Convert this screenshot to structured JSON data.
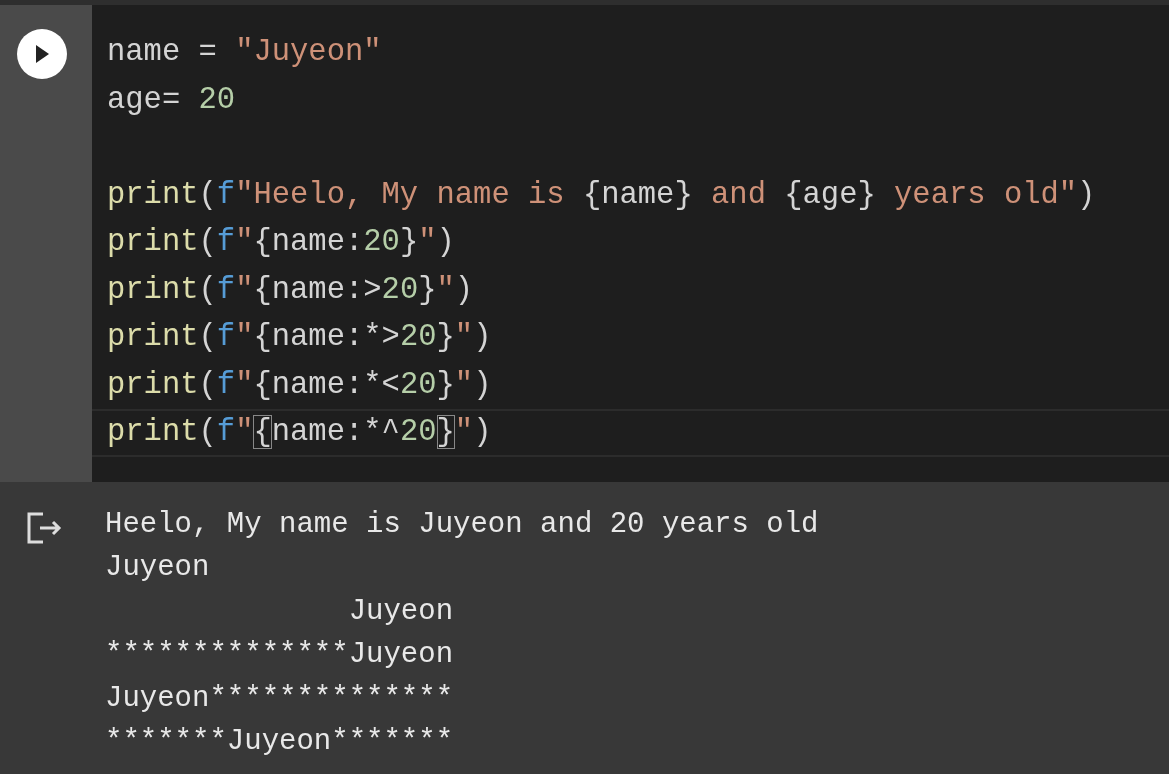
{
  "code_cell": {
    "lines": [
      {
        "kind": "code",
        "current": false,
        "tokens": [
          {
            "kind": "plain",
            "text": "name = "
          },
          {
            "kind": "string",
            "text": "\"Juyeon\""
          }
        ]
      },
      {
        "kind": "code",
        "current": false,
        "tokens": [
          {
            "kind": "plain",
            "text": "age= "
          },
          {
            "kind": "number",
            "text": "20"
          }
        ]
      },
      {
        "kind": "blank"
      },
      {
        "kind": "code",
        "current": false,
        "tokens": [
          {
            "kind": "function",
            "text": "print"
          },
          {
            "kind": "plain",
            "text": "("
          },
          {
            "kind": "prefix",
            "text": "f"
          },
          {
            "kind": "string",
            "text": "\"Heelo, My name is "
          },
          {
            "kind": "plain",
            "text": "{name}"
          },
          {
            "kind": "string",
            "text": " and "
          },
          {
            "kind": "plain",
            "text": "{age}"
          },
          {
            "kind": "string",
            "text": " years old\""
          },
          {
            "kind": "plain",
            "text": ")"
          }
        ]
      },
      {
        "kind": "code",
        "current": false,
        "tokens": [
          {
            "kind": "function",
            "text": "print"
          },
          {
            "kind": "plain",
            "text": "("
          },
          {
            "kind": "prefix",
            "text": "f"
          },
          {
            "kind": "string",
            "text": "\""
          },
          {
            "kind": "plain",
            "text": "{name:"
          },
          {
            "kind": "number",
            "text": "20"
          },
          {
            "kind": "plain",
            "text": "}"
          },
          {
            "kind": "string",
            "text": "\""
          },
          {
            "kind": "plain",
            "text": ")"
          }
        ]
      },
      {
        "kind": "code",
        "current": false,
        "tokens": [
          {
            "kind": "function",
            "text": "print"
          },
          {
            "kind": "plain",
            "text": "("
          },
          {
            "kind": "prefix",
            "text": "f"
          },
          {
            "kind": "string",
            "text": "\""
          },
          {
            "kind": "plain",
            "text": "{name:>"
          },
          {
            "kind": "number",
            "text": "20"
          },
          {
            "kind": "plain",
            "text": "}"
          },
          {
            "kind": "string",
            "text": "\""
          },
          {
            "kind": "plain",
            "text": ")"
          }
        ]
      },
      {
        "kind": "code",
        "current": false,
        "tokens": [
          {
            "kind": "function",
            "text": "print"
          },
          {
            "kind": "plain",
            "text": "("
          },
          {
            "kind": "prefix",
            "text": "f"
          },
          {
            "kind": "string",
            "text": "\""
          },
          {
            "kind": "plain",
            "text": "{name:*>"
          },
          {
            "kind": "number",
            "text": "20"
          },
          {
            "kind": "plain",
            "text": "}"
          },
          {
            "kind": "string",
            "text": "\""
          },
          {
            "kind": "plain",
            "text": ")"
          }
        ]
      },
      {
        "kind": "code",
        "current": false,
        "tokens": [
          {
            "kind": "function",
            "text": "print"
          },
          {
            "kind": "plain",
            "text": "("
          },
          {
            "kind": "prefix",
            "text": "f"
          },
          {
            "kind": "string",
            "text": "\""
          },
          {
            "kind": "plain",
            "text": "{name:*<"
          },
          {
            "kind": "number",
            "text": "20"
          },
          {
            "kind": "plain",
            "text": "}"
          },
          {
            "kind": "string",
            "text": "\""
          },
          {
            "kind": "plain",
            "text": ")"
          }
        ]
      },
      {
        "kind": "code",
        "current": true,
        "tokens": [
          {
            "kind": "function",
            "text": "print"
          },
          {
            "kind": "plain",
            "text": "("
          },
          {
            "kind": "prefix",
            "text": "f"
          },
          {
            "kind": "string",
            "text": "\""
          },
          {
            "kind": "bracket",
            "text": "{"
          },
          {
            "kind": "plain",
            "text": "name:*^"
          },
          {
            "kind": "number",
            "text": "20"
          },
          {
            "kind": "bracket",
            "text": "}"
          },
          {
            "kind": "string",
            "text": "\""
          },
          {
            "kind": "plain",
            "text": ")"
          }
        ]
      }
    ]
  },
  "output": {
    "lines": [
      "Heelo, My name is Juyeon and 20 years old",
      "Juyeon",
      "              Juyeon",
      "**************Juyeon",
      "Juyeon**************",
      "*******Juyeon*******"
    ]
  }
}
